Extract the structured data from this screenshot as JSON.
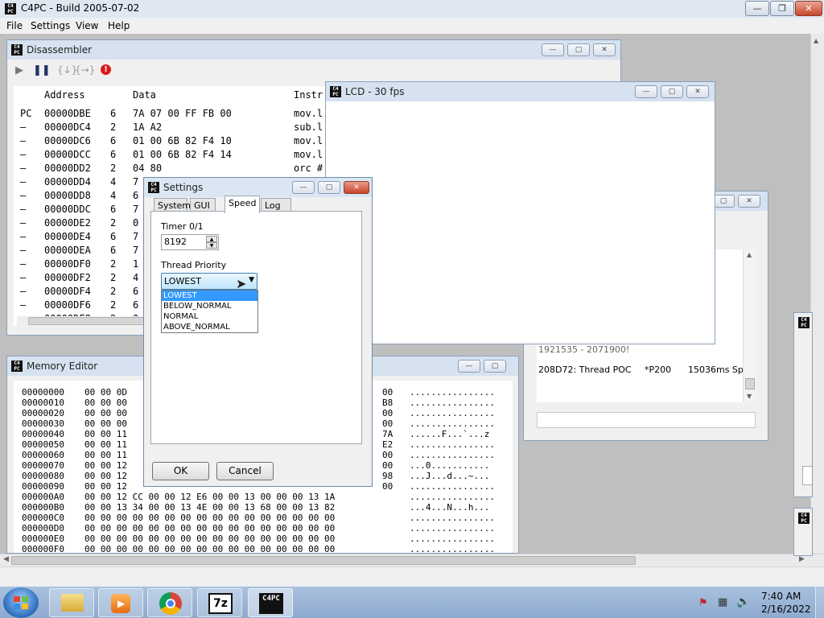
{
  "app": {
    "title": "C4PC - Build 2005-07-02",
    "icon_text": "C4PC",
    "caption_min": "—",
    "caption_max": "❐",
    "caption_close": "✕"
  },
  "menu": [
    "File",
    "Settings",
    "View",
    "Help"
  ],
  "disassembler": {
    "title": "Disassembler",
    "columns": [
      "Address",
      "Data",
      "Instr"
    ],
    "rows": [
      {
        "m": "PC",
        "addr": "00000DBE",
        "len": "6",
        "data": "7A 07 00 FF FB 00",
        "ins": "mov.l"
      },
      {
        "m": "–",
        "addr": "00000DC4",
        "len": "2",
        "data": "1A A2",
        "ins": "sub.l"
      },
      {
        "m": "–",
        "addr": "00000DC6",
        "len": "6",
        "data": "01 00 6B 82 F4 10",
        "ins": "mov.l"
      },
      {
        "m": "–",
        "addr": "00000DCC",
        "len": "6",
        "data": "01 00 6B 82 F4 14",
        "ins": "mov.l"
      },
      {
        "m": "–",
        "addr": "00000DD2",
        "len": "2",
        "data": "04 80",
        "ins": "orc #"
      },
      {
        "m": "–",
        "addr": "00000DD4",
        "len": "4",
        "data": "7",
        "ins": ""
      },
      {
        "m": "–",
        "addr": "00000DD8",
        "len": "4",
        "data": "6",
        "ins": ""
      },
      {
        "m": "–",
        "addr": "00000DDC",
        "len": "6",
        "data": "7",
        "ins": ""
      },
      {
        "m": "–",
        "addr": "00000DE2",
        "len": "2",
        "data": "0",
        "ins": ""
      },
      {
        "m": "–",
        "addr": "00000DE4",
        "len": "6",
        "data": "7",
        "ins": ""
      },
      {
        "m": "–",
        "addr": "00000DEA",
        "len": "6",
        "data": "7",
        "ins": ""
      },
      {
        "m": "–",
        "addr": "00000DF0",
        "len": "2",
        "data": "1",
        "ins": ""
      },
      {
        "m": "–",
        "addr": "00000DF2",
        "len": "2",
        "data": "4",
        "ins": ""
      },
      {
        "m": "–",
        "addr": "00000DF4",
        "len": "2",
        "data": "6",
        "ins": ""
      },
      {
        "m": "–",
        "addr": "00000DF6",
        "len": "2",
        "data": "6",
        "ins": ""
      },
      {
        "m": "–",
        "addr": "00000DF8",
        "len": "2",
        "data": "0",
        "ins": ""
      }
    ]
  },
  "lcd": {
    "title": "LCD - 30 fps"
  },
  "log": {
    "lines": [
      {
        "a": "1921535 - 2071900!",
        "b": "",
        "c": ""
      },
      {
        "a": "208D72: Thread POC",
        "b": "*P200",
        "c": "15036ms Sp"
      }
    ]
  },
  "memory": {
    "title": "Memory Editor",
    "rows": [
      {
        "addr": "00000000",
        "left": "00 00 0D",
        "right": "00",
        "ascii": "................"
      },
      {
        "addr": "00000010",
        "left": "00 00 00",
        "right": "B8",
        "ascii": "................"
      },
      {
        "addr": "00000020",
        "left": "00 00 00",
        "right": "00",
        "ascii": "................"
      },
      {
        "addr": "00000030",
        "left": "00 00 00",
        "right": "00",
        "ascii": "................"
      },
      {
        "addr": "00000040",
        "left": "00 00 11",
        "right": "7A",
        "ascii": "......F...`...z"
      },
      {
        "addr": "00000050",
        "left": "00 00 11",
        "right": "E2",
        "ascii": "................"
      },
      {
        "addr": "00000060",
        "left": "00 00 11",
        "right": "00",
        "ascii": "................"
      },
      {
        "addr": "00000070",
        "left": "00 00 12",
        "right": "00",
        "ascii": "...0..........."
      },
      {
        "addr": "00000080",
        "left": "00 00 12",
        "right": "98",
        "ascii": "...J...d...~..."
      },
      {
        "addr": "00000090",
        "left": "00 00 12",
        "right": "00",
        "ascii": "................"
      },
      {
        "addr": "000000A0",
        "left": "00 00 12 CC 00 00 12 E6 00 00 13 00 00 00 13 1A",
        "right": "",
        "ascii": "................"
      },
      {
        "addr": "000000B0",
        "left": "00 00 13 34 00 00 13 4E 00 00 13 68 00 00 13 82",
        "right": "",
        "ascii": "...4...N...h..."
      },
      {
        "addr": "000000C0",
        "left": "00 00 00 00 00 00 00 00 00 00 00 00 00 00 00 00",
        "right": "",
        "ascii": "................"
      },
      {
        "addr": "000000D0",
        "left": "00 00 00 00 00 00 00 00 00 00 00 00 00 00 00 00",
        "right": "",
        "ascii": "................"
      },
      {
        "addr": "000000E0",
        "left": "00 00 00 00 00 00 00 00 00 00 00 00 00 00 00 00",
        "right": "",
        "ascii": "................"
      },
      {
        "addr": "000000F0",
        "left": "00 00 00 00 00 00 00 00 00 00 00 00 00 00 00 00",
        "right": "",
        "ascii": "................"
      }
    ]
  },
  "settings": {
    "title": "Settings",
    "tabs": [
      "System",
      "GUI",
      "Speed",
      "Log"
    ],
    "active_tab": "Speed",
    "timer_label": "Timer 0/1",
    "timer_value": "8192",
    "priority_label": "Thread Priority",
    "priority_selected": "LOWEST",
    "priority_options": [
      "LOWEST",
      "BELOW_NORMAL",
      "NORMAL",
      "ABOVE_NORMAL"
    ],
    "ok_label": "OK",
    "cancel_label": "Cancel"
  },
  "taskbar": {
    "time": "7:40 AM",
    "date": "2/16/2022",
    "seven_zip": "7z",
    "c4pc": "C4PC"
  },
  "colors": {
    "highlight": "#3399ff",
    "title_active": "#dfe7f1",
    "taskbar": "#9ab4d6"
  }
}
